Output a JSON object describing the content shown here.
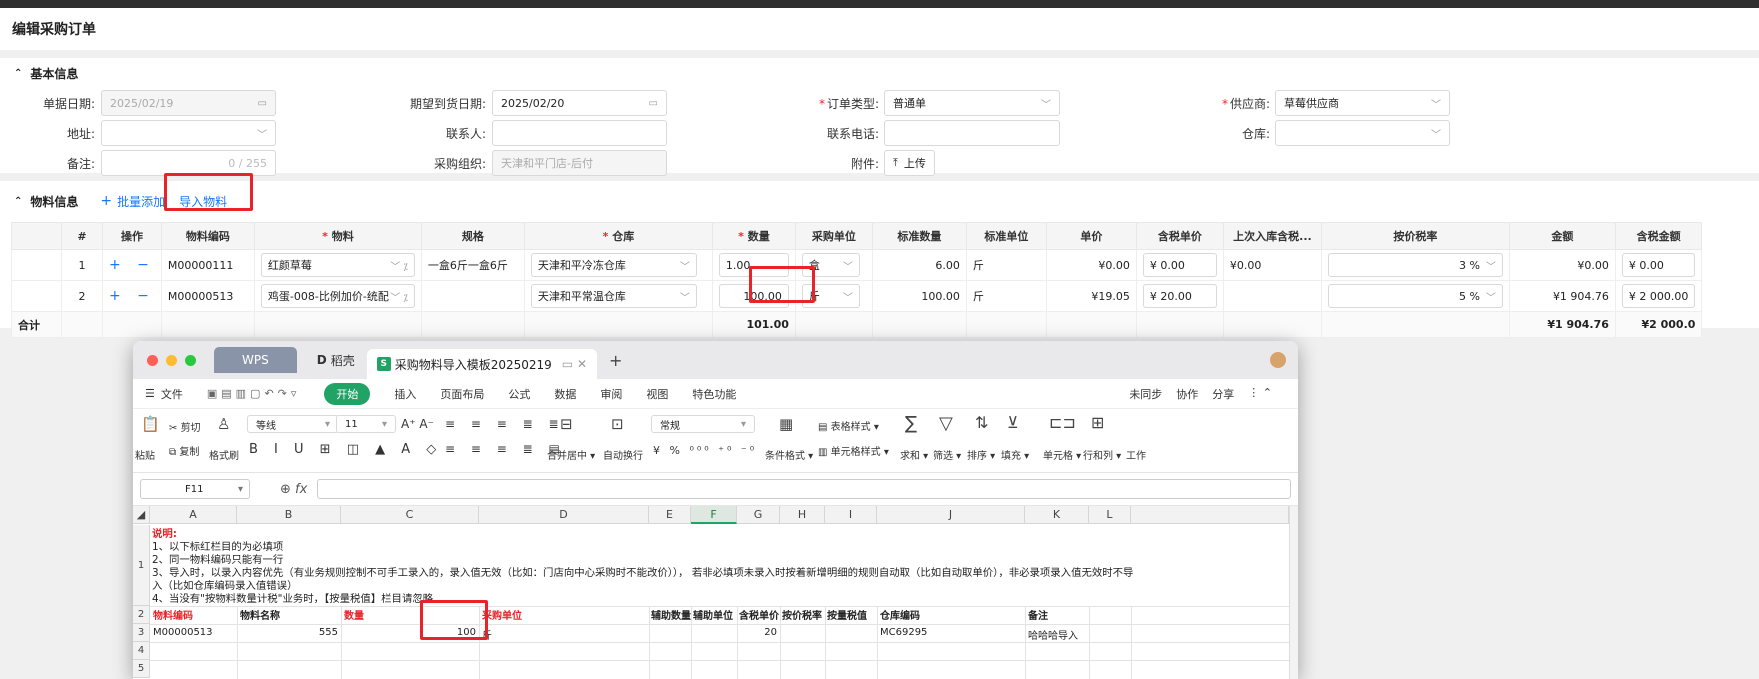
{
  "page": {
    "title": "编辑采购订单"
  },
  "basic": {
    "section_title": "基本信息",
    "order_date": {
      "label": "单据日期:",
      "value": "2025/02/19"
    },
    "expected_date": {
      "label": "期望到货日期:",
      "value": "2025/02/20"
    },
    "order_type": {
      "label": "订单类型:",
      "value": "普通单"
    },
    "supplier": {
      "label": "供应商:",
      "value": "草莓供应商"
    },
    "address": {
      "label": "地址:"
    },
    "contact": {
      "label": "联系人:"
    },
    "phone": {
      "label": "联系电话:"
    },
    "warehouse": {
      "label": "仓库:"
    },
    "remark": {
      "label": "备注:",
      "counter": "0 / 255"
    },
    "purchase_org": {
      "label": "采购组织:",
      "value": "天津和平门店-后付"
    },
    "attachment": {
      "label": "附件:",
      "button": "上传"
    }
  },
  "materials": {
    "section_title": "物料信息",
    "batch_add": "批量添加",
    "import": "导入物料",
    "columns": [
      "#",
      "操作",
      "物料编码",
      "物料",
      "规格",
      "仓库",
      "数量",
      "采购单位",
      "标准数量",
      "标准单位",
      "单价",
      "含税单价",
      "上次入库含税...",
      "按价税率",
      "金额",
      "含税金额"
    ],
    "rows": [
      {
        "idx": "1",
        "ops": "+ −",
        "code": "M00000111",
        "name": "红颜草莓",
        "spec": "一盒6斤一盒6斤",
        "warehouse": "天津和平冷冻仓库",
        "qty": "1.00",
        "unit": "盒",
        "std_qty": "6.00",
        "std_unit": "斤",
        "price": "¥0.00",
        "tax_price": "¥ 0.00",
        "last_price": "¥0.00",
        "tax_rate": "3 %",
        "amount": "¥0.00",
        "tax_amount": "¥ 0.00"
      },
      {
        "idx": "2",
        "ops": "+ −",
        "code": "M00000513",
        "name": "鸡蛋-008-比例加价-统配",
        "spec": "",
        "warehouse": "天津和平常温仓库",
        "qty": "100.00",
        "unit": "斤",
        "std_qty": "100.00",
        "std_unit": "斤",
        "price": "¥19.05",
        "tax_price": "¥ 20.00",
        "last_price": "",
        "tax_rate": "5 %",
        "amount": "¥1 904.76",
        "tax_amount": "¥ 2 000.00"
      }
    ],
    "total": {
      "label": "合计",
      "qty": "101.00",
      "amount": "¥1 904.76",
      "tax_amount": "¥2 000.0"
    }
  },
  "wps": {
    "tab_wps": "WPS",
    "tab_dk": "稻壳",
    "tab_file": "采购物料导入模板20250219",
    "menu": [
      "文件",
      "开始",
      "插入",
      "页面布局",
      "公式",
      "数据",
      "审阅",
      "视图",
      "特色功能"
    ],
    "menu_right": [
      "未同步",
      "协作",
      "分享"
    ],
    "ribbon": {
      "paste": "粘贴",
      "cut": "剪切",
      "copy": "复制",
      "format_painter": "格式刷",
      "font": "等线",
      "size": "11",
      "merge": "合并居中",
      "wrap": "自动换行",
      "numfmt": "常规",
      "cond": "条件格式",
      "table_style": "表格样式",
      "cell_style": "单元格样式",
      "sum": "求和",
      "filter": "筛选",
      "sort": "排序",
      "fill": "填充",
      "cell": "单元格",
      "rowcol": "行和列",
      "work": "工作"
    },
    "namebox": "F11",
    "columns": [
      "A",
      "B",
      "C",
      "D",
      "E",
      "F",
      "G",
      "H",
      "I",
      "J",
      "K",
      "L"
    ],
    "rows": [
      "1",
      "2",
      "3",
      "4",
      "5"
    ],
    "note": {
      "title": "说明:",
      "l1": "1、以下标红栏目的为必填项",
      "l2": "2、同一物料编码只能有一行",
      "l3": "3、导入时，以录入内容优先（有业务规则控制不可手工录入的，录入值无效（比如：门店向中心采购时不能改价））， 若非必填项未录入时按着新增明细的规则自动取（比如自动取单价），非必录项录入值无效时不导",
      "l3b": "入（比如仓库编码录入值错误）",
      "l4": "4、当没有\"按物料数量计税\"业务时，【按量税值】栏目请忽略"
    },
    "headers": {
      "A": "物料编码",
      "B": "物料名称",
      "C": "数量",
      "D": "采购单位",
      "E": "辅助数量",
      "F": "辅助单位",
      "G": "含税单价",
      "H": "按价税率",
      "I": "按量税值",
      "J": "仓库编码",
      "K": "备注"
    },
    "data": {
      "A": "M00000513",
      "B": "555",
      "C": "100",
      "D": "斤",
      "G": "20",
      "J": "MC69295",
      "K": "哈哈哈导入"
    }
  }
}
